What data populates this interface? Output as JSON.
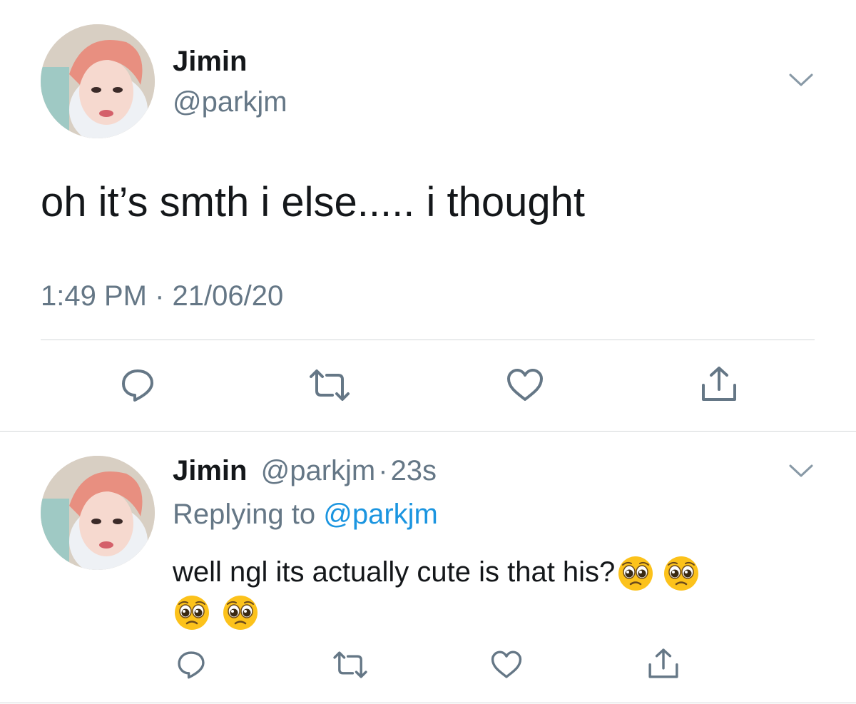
{
  "main_tweet": {
    "display_name": "Jimin",
    "handle": "@parkjm",
    "text": "oh it’s smth i else..... i thought",
    "timestamp": "1:49 PM · 21/06/20"
  },
  "reply": {
    "display_name": "Jimin",
    "handle": "@parkjm",
    "separator": "·",
    "time_ago": "23s",
    "replying_prefix": "Replying to",
    "replying_handle": "@parkjm",
    "text": "well ngl its actually cute is that his?",
    "emoji_count": 4
  },
  "colors": {
    "text": "#14171a",
    "muted": "#657786",
    "link": "#1b95e0",
    "divider": "#d3d6d9",
    "icon": "#657786"
  },
  "icons": {
    "reply": "reply-icon",
    "retweet": "retweet-icon",
    "like": "heart-icon",
    "share": "share-icon",
    "menu": "chevron-down-icon",
    "emoji": "pleading-face-emoji"
  }
}
